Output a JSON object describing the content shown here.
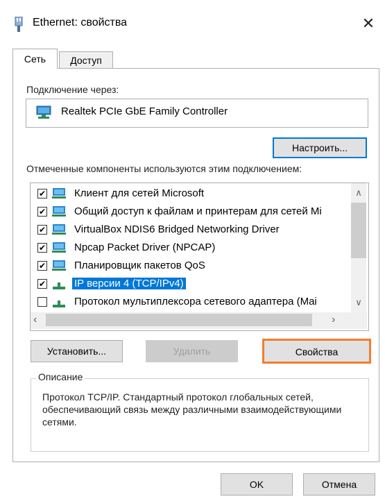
{
  "window": {
    "title": "Ethernet: свойства",
    "close_symbol": "✕"
  },
  "tabs": [
    {
      "label": "Сеть",
      "active": true
    },
    {
      "label": "Доступ",
      "active": false
    }
  ],
  "connection": {
    "label": "Подключение через:",
    "adapter": "Realtek PCIe GbE Family Controller",
    "configure_label": "Настроить..."
  },
  "components": {
    "label": "Отмеченные компоненты используются этим подключением:",
    "items": [
      {
        "label": "Клиент для сетей Microsoft",
        "checked": true,
        "icon": "network-client-icon",
        "selected": false
      },
      {
        "label": "Общий доступ к файлам и принтерам для сетей Mi",
        "checked": true,
        "icon": "network-service-icon",
        "selected": false
      },
      {
        "label": "VirtualBox NDIS6 Bridged Networking Driver",
        "checked": true,
        "icon": "network-service-icon",
        "selected": false
      },
      {
        "label": "Npcap Packet Driver (NPCAP)",
        "checked": true,
        "icon": "network-service-icon",
        "selected": false
      },
      {
        "label": "Планировщик пакетов QoS",
        "checked": true,
        "icon": "network-service-icon",
        "selected": false
      },
      {
        "label": "IP версии 4 (TCP/IPv4)",
        "checked": true,
        "icon": "protocol-icon",
        "selected": true
      },
      {
        "label": "Протокол мультиплексора сетевого адаптера (Mai",
        "checked": false,
        "icon": "protocol-icon",
        "selected": false
      }
    ]
  },
  "actions": {
    "install_label": "Установить...",
    "remove_label": "Удалить",
    "properties_label": "Свойства",
    "highlight_color": "#f07f2b"
  },
  "description": {
    "title": "Описание",
    "text": "Протокол TCP/IP. Стандартный протокол глобальных сетей, обеспечивающий связь между различными взаимодействующими сетями."
  },
  "footer": {
    "ok_label": "OK",
    "cancel_label": "Отмена"
  },
  "colors": {
    "selection": "#0078d7",
    "button_bg": "#e1e1e1"
  }
}
